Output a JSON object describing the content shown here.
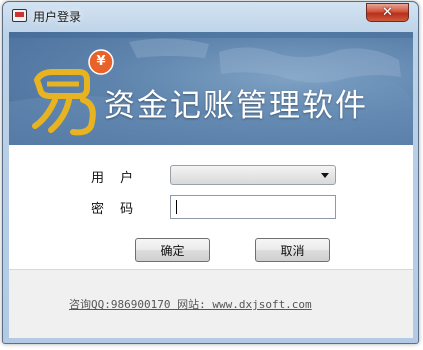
{
  "window": {
    "title": "用户登录",
    "close_label": "✕"
  },
  "banner": {
    "logo_char": "易",
    "coin_symbol": "¥",
    "product_name": "资金记账管理软件"
  },
  "form": {
    "user_label": "用 户",
    "user_value": "",
    "password_label": "密 码",
    "password_value": ""
  },
  "buttons": {
    "ok": "确定",
    "cancel": "取消"
  },
  "footer": {
    "contact": "咨询QQ:986900170  网站: www.dxjsoft.com"
  },
  "colors": {
    "banner": "#5e84ad",
    "close": "#c8412a",
    "window_frame": "#bcd2e8"
  }
}
